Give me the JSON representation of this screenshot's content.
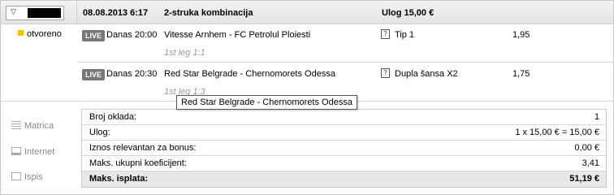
{
  "header": {
    "date_time": "08.08.2013 6:17",
    "bet_type": "2-struka kombinacija",
    "stake": "Ulog 15,00 €"
  },
  "status": "otvoreno",
  "matches": [
    {
      "live": "LIVE",
      "time": "Danas 20:00",
      "teams": "Vitesse Arnhem - FC Petrolul Ploiesti",
      "leg": "1st leg 1:1",
      "tip": "Tip 1",
      "odd": "1,95"
    },
    {
      "live": "LIVE",
      "time": "Danas 20:30",
      "teams": "Red Star Belgrade - Chernomorets Odessa",
      "leg": "1st leg 1:3",
      "tip": "Dupla šansa X2",
      "odd": "1,75"
    }
  ],
  "sidebar": [
    {
      "label": "Matrica",
      "icon": "list-icon"
    },
    {
      "label": "Internet",
      "icon": "monitor-icon"
    },
    {
      "label": "Ispis",
      "icon": "printer-icon"
    }
  ],
  "summary": [
    {
      "label": "Broj oklada:",
      "value": "1"
    },
    {
      "label": "Ulog:",
      "value": "1 x 15,00 € = 15,00 €"
    },
    {
      "label": "Iznos relevantan za bonus:",
      "value": "0,00 €"
    },
    {
      "label": "Maks. ukupni koeficijent:",
      "value": "3,41"
    },
    {
      "label": "Maks. isplata:",
      "value": "51,19 €"
    }
  ],
  "tooltip": "Red Star Belgrade - Chernomorets Odessa",
  "colors": {
    "status_open": "#f5c400",
    "live_badge": "#777777"
  }
}
